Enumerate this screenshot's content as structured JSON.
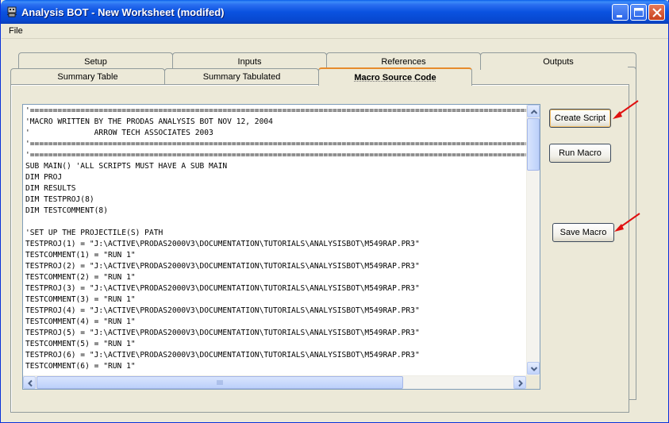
{
  "window": {
    "title": "Analysis BOT - New Worksheet (modifed)"
  },
  "menu": {
    "file": "File"
  },
  "tabs_back": [
    {
      "label": "Setup"
    },
    {
      "label": "Inputs"
    },
    {
      "label": "References"
    },
    {
      "label": "Outputs"
    }
  ],
  "tabs_front": [
    {
      "label": "Summary Table"
    },
    {
      "label": "Summary Tabulated"
    },
    {
      "label": "Macro Source Code"
    }
  ],
  "active_tab": "Macro Source Code",
  "buttons": {
    "create_script": "Create Script",
    "run_macro": "Run Macro",
    "save_macro": "Save  Macro"
  },
  "code_lines": [
    "'=====================================================================================================================",
    "'MACRO WRITTEN BY THE PRODAS ANALYSIS BOT NOV 12, 2004",
    "'              ARROW TECH ASSOCIATES 2003",
    "'=====================================================================================================================",
    "'=====================================================================================================================",
    "SUB MAIN() 'ALL SCRIPTS MUST HAVE A SUB MAIN",
    "DIM PROJ",
    "DIM RESULTS",
    "DIM TESTPROJ(8)",
    "DIM TESTCOMMENT(8)",
    "",
    "'SET UP THE PROJECTILE(S) PATH",
    "TESTPROJ(1) = \"J:\\ACTIVE\\PRODAS2000V3\\DOCUMENTATION\\TUTORIALS\\ANALYSISBOT\\M549RAP.PR3\"",
    "TESTCOMMENT(1) = \"RUN 1\"",
    "TESTPROJ(2) = \"J:\\ACTIVE\\PRODAS2000V3\\DOCUMENTATION\\TUTORIALS\\ANALYSISBOT\\M549RAP.PR3\"",
    "TESTCOMMENT(2) = \"RUN 1\"",
    "TESTPROJ(3) = \"J:\\ACTIVE\\PRODAS2000V3\\DOCUMENTATION\\TUTORIALS\\ANALYSISBOT\\M549RAP.PR3\"",
    "TESTCOMMENT(3) = \"RUN 1\"",
    "TESTPROJ(4) = \"J:\\ACTIVE\\PRODAS2000V3\\DOCUMENTATION\\TUTORIALS\\ANALYSISBOT\\M549RAP.PR3\"",
    "TESTCOMMENT(4) = \"RUN 1\"",
    "TESTPROJ(5) = \"J:\\ACTIVE\\PRODAS2000V3\\DOCUMENTATION\\TUTORIALS\\ANALYSISBOT\\M549RAP.PR3\"",
    "TESTCOMMENT(5) = \"RUN 1\"",
    "TESTPROJ(6) = \"J:\\ACTIVE\\PRODAS2000V3\\DOCUMENTATION\\TUTORIALS\\ANALYSISBOT\\M549RAP.PR3\"",
    "TESTCOMMENT(6) = \"RUN 1\""
  ],
  "colors": {
    "titlebar": "#0a52e0",
    "face": "#ece9d8",
    "annotation_arrow": "#e01010",
    "active_tab_accent": "#e68b2c"
  },
  "icons": {
    "app": "robot-icon",
    "minimize": "minimize-icon",
    "maximize": "maximize-icon",
    "close": "close-icon"
  }
}
